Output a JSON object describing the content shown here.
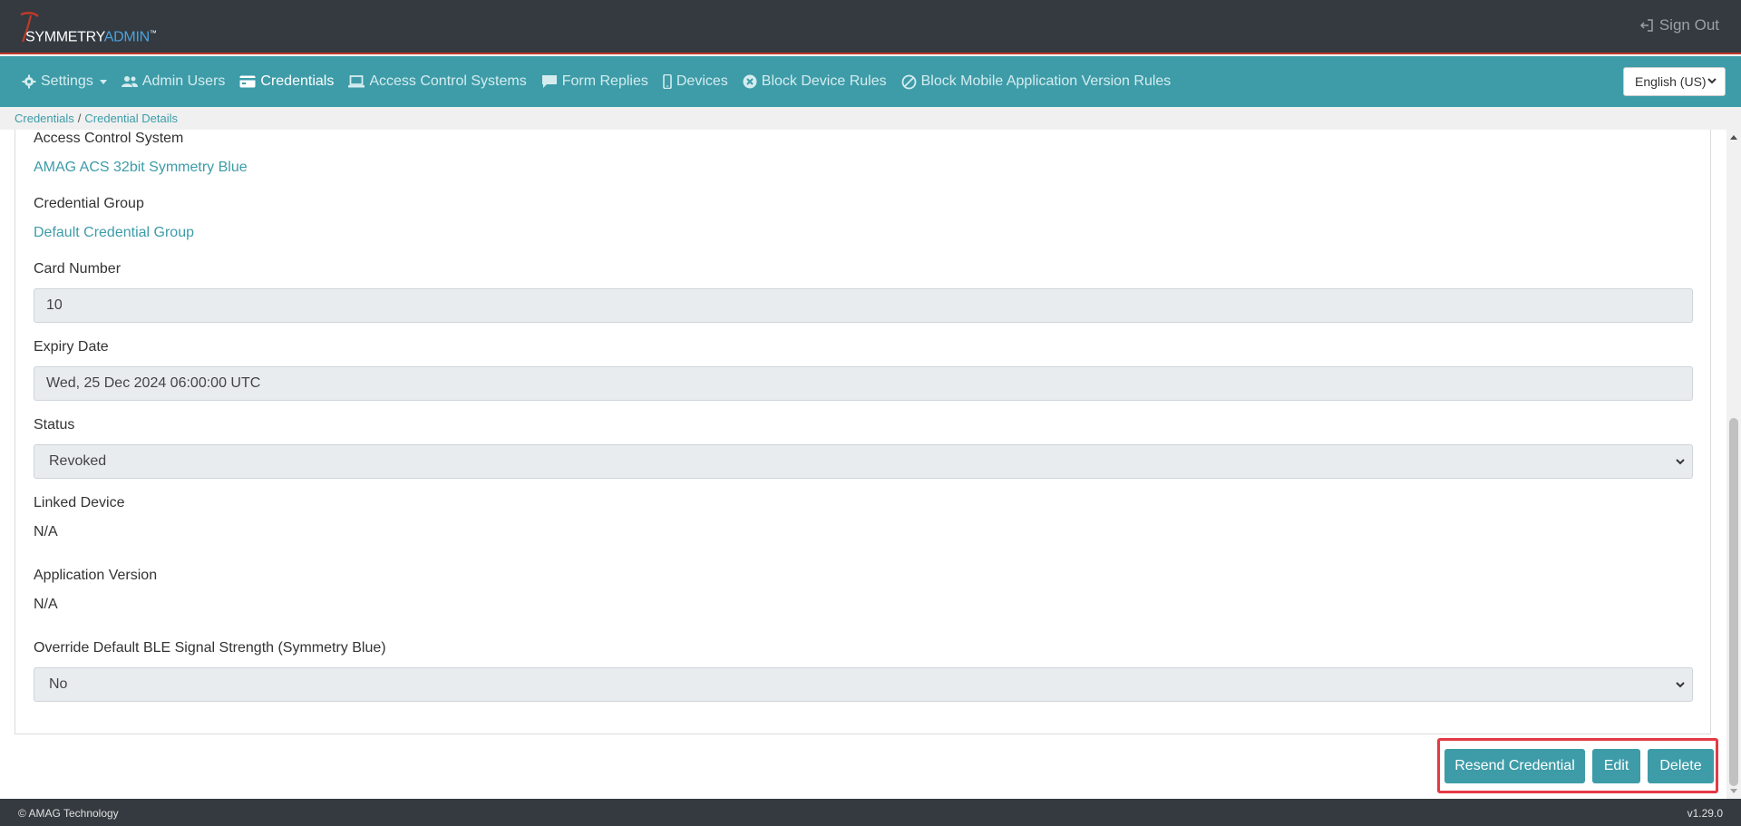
{
  "header": {
    "logo_part1": "SYMMETRY",
    "logo_part2": "ADMIN",
    "logo_tm": "™",
    "sign_out_label": "Sign Out",
    "sign_out_icon": "sign-out-icon"
  },
  "nav": {
    "items": [
      {
        "label": "Settings",
        "icon": "gear-icon"
      },
      {
        "label": "Admin Users",
        "icon": "users-icon"
      },
      {
        "label": "Credentials",
        "icon": "card-icon",
        "active": true
      },
      {
        "label": "Access Control Systems",
        "icon": "laptop-icon"
      },
      {
        "label": "Form Replies",
        "icon": "comment-icon"
      },
      {
        "label": "Devices",
        "icon": "mobile-icon"
      },
      {
        "label": "Block Device Rules",
        "icon": "x-circle-icon"
      },
      {
        "label": "Block Mobile Application Version Rules",
        "icon": "ban-icon"
      }
    ],
    "language": "English (US)"
  },
  "breadcrumb": {
    "items": [
      "Credentials",
      "Credential Details"
    ],
    "separator": "/"
  },
  "form": {
    "acs_label": "Access Control System",
    "acs_value": "AMAG ACS 32bit Symmetry Blue",
    "group_label": "Credential Group",
    "group_value": "Default Credential Group",
    "card_label": "Card Number",
    "card_value": "10",
    "expiry_label": "Expiry Date",
    "expiry_value": "Wed, 25 Dec 2024 06:00:00 UTC",
    "status_label": "Status",
    "status_value": "Revoked",
    "linked_label": "Linked Device",
    "linked_value": "N/A",
    "appver_label": "Application Version",
    "appver_value": "N/A",
    "ble_label": "Override Default BLE Signal Strength (Symmetry Blue)",
    "ble_value": "No"
  },
  "actions": {
    "resend_label": "Resend Credential",
    "edit_label": "Edit",
    "delete_label": "Delete"
  },
  "footer": {
    "copyright": "© AMAG Technology",
    "version": "v1.29.0"
  },
  "colors": {
    "header_bg": "#343a40",
    "nav_bg": "#3d9ca8",
    "accent": "#3d9ca8",
    "highlight_border": "#e53946"
  }
}
